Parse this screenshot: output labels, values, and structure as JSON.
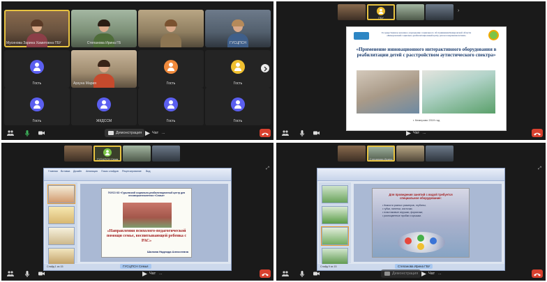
{
  "toolbar": {
    "share_label": "Демонстрация",
    "chat_label": "Чат",
    "more_label": "...",
    "leave_color": "#d8412f"
  },
  "q1": {
    "tiles": [
      {
        "name": "Мусинова Зарина Хамитовна ГБУ",
        "type": "video",
        "active": true
      },
      {
        "name": "Степанова Ирина ГБ",
        "type": "video"
      },
      {
        "name": "",
        "type": "video"
      },
      {
        "name": "ГУСЦПСН",
        "type": "video"
      },
      {
        "name": "Гость",
        "type": "avatar",
        "color": "blue"
      },
      {
        "name": "Арзуна Мария",
        "type": "video"
      },
      {
        "name": "Гость",
        "type": "avatar",
        "color": "orange"
      },
      {
        "name": "Гость",
        "type": "avatar",
        "color": "yellow"
      },
      {
        "name": "Гость",
        "type": "avatar",
        "color": "blue"
      },
      {
        "name": "ЖКДССМ",
        "type": "avatar",
        "color": "blue"
      },
      {
        "name": "Гость",
        "type": "avatar",
        "color": "blue"
      },
      {
        "name": "Гость",
        "type": "avatar",
        "color": "blue"
      }
    ]
  },
  "q2": {
    "mini": [
      "",
      "ГБУ",
      "",
      ""
    ],
    "slide": {
      "org": "Государственное казенное учреждение социального обслуживания Кемеровской области «Кемеровский социально-реабилитационный центр для несовершеннолетних»",
      "title": "«Применение инновационного интерактивного оборудования в реабилитации детей с расстройством аутистического спектра»",
      "footer": "г. Кемерово 2019 год"
    }
  },
  "q3": {
    "mini": [
      "",
      "ГУСЦПСН Сема",
      "",
      ""
    ],
    "ribbon_tabs": [
      "Главная",
      "Вставка",
      "Дизайн",
      "Анимация",
      "Показ слайдов",
      "Рецензирование",
      "Вид"
    ],
    "slide": {
      "header": "ГКУСО КО «Гурьевский социально-реабилитационный центр для несовершеннолетних «Семья»",
      "title": "«Направления психолого-педагогической помощи семье, воспитывающей ребенка с РАС»",
      "author": "Шилова Надежда Алексеевна"
    },
    "status_left": "Слайд 1 из 15",
    "share_label": "ГУСЦПСН Семья"
  },
  "q4": {
    "mini": [
      "",
      "Степанова Ирина",
      "",
      ""
    ],
    "slide": {
      "header": "Для проведения занятий с водой требуется специальное оборудование:",
      "bullets": [
        "• ёмкости разных размеров, глубины;",
        "• губки, пипетки, кисточки;",
        "• пластиковые игрушки, формочки;",
        "• разноцветные пробки и крышки."
      ]
    },
    "status_left": "Слайд 9 из 15",
    "share_label": "Степанова Ирина ГБУ"
  },
  "colors": {
    "avatar_blue": "#5b5ff0",
    "avatar_orange": "#f08a3c",
    "avatar_yellow": "#f0c030",
    "active_speaker": "#e8c341"
  }
}
